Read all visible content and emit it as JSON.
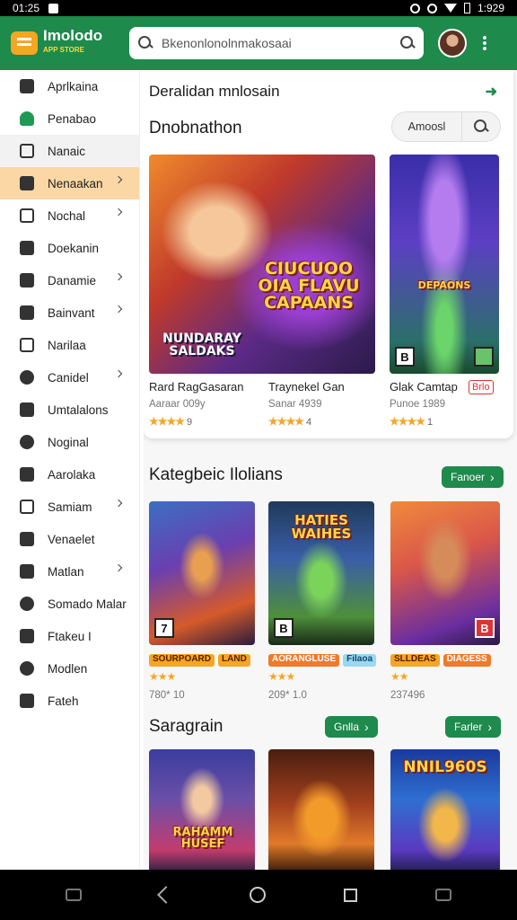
{
  "status_bar": {
    "time": "01:25",
    "clock": "1:929"
  },
  "header": {
    "logo_text": "Imolodo",
    "logo_sub": "APP STORE",
    "search_placeholder": "Bkenonlonolnmakosaai"
  },
  "sidebar": {
    "items": [
      {
        "label": "Aprlkaina",
        "icon": "home-icon",
        "chevron": false,
        "state": ""
      },
      {
        "label": "Penabao",
        "icon": "shop-icon",
        "chevron": false,
        "state": ""
      },
      {
        "label": "Nanaic",
        "icon": "square-icon",
        "chevron": false,
        "state": "grey"
      },
      {
        "label": "Nenaakan",
        "icon": "user-icon",
        "chevron": true,
        "state": "active"
      },
      {
        "label": "Nochal",
        "icon": "box-icon",
        "chevron": true,
        "state": ""
      },
      {
        "label": "Doekanin",
        "icon": "person-icon",
        "chevron": false,
        "state": ""
      },
      {
        "label": "Danamie",
        "icon": "leaf-icon",
        "chevron": true,
        "state": ""
      },
      {
        "label": "Bainvant",
        "icon": "tools-icon",
        "chevron": true,
        "state": ""
      },
      {
        "label": "Narilaa",
        "icon": "image-icon",
        "chevron": false,
        "state": ""
      },
      {
        "label": "Canidel",
        "icon": "tag-icon",
        "chevron": true,
        "state": ""
      },
      {
        "label": "Umtalalons",
        "icon": "grid-icon",
        "chevron": false,
        "state": ""
      },
      {
        "label": "Noginal",
        "icon": "globe-icon",
        "chevron": false,
        "state": ""
      },
      {
        "label": "Aarolaka",
        "icon": "picture-icon",
        "chevron": false,
        "state": ""
      },
      {
        "label": "Samiam",
        "icon": "list-icon",
        "chevron": true,
        "state": ""
      },
      {
        "label": "Venaelet",
        "icon": "apps-icon",
        "chevron": false,
        "state": ""
      },
      {
        "label": "Matlan",
        "icon": "profile-icon",
        "chevron": true,
        "state": ""
      },
      {
        "label": "Somado Malar",
        "icon": "target-icon",
        "chevron": false,
        "state": ""
      },
      {
        "label": "Ftakeu I",
        "icon": "feather-icon",
        "chevron": false,
        "state": ""
      },
      {
        "label": "Modlen",
        "icon": "circle-icon",
        "chevron": false,
        "state": ""
      },
      {
        "label": "Fateh",
        "icon": "pen-icon",
        "chevron": false,
        "state": ""
      }
    ]
  },
  "main": {
    "top_heading": "Deralidan mnlosain",
    "featured_title": "Dnobnathon",
    "filter_label": "Amoosl",
    "featured_cards": [
      {
        "name": "Rard RagGasaran",
        "meta": "Aaraar 009y",
        "rating": "★★★★",
        "rating_num": "9",
        "art_title": "CIUCUOO OIA FLAVU CAPAANS",
        "art_sub": "NUNDARAY SALDAKS",
        "badge": ""
      },
      {
        "name": "Traynekel Gan",
        "meta": "Sanar 4939",
        "rating": "★★★★",
        "rating_num": "4",
        "art_title": "",
        "art_sub": "",
        "badge": ""
      },
      {
        "name": "Glak Camtap",
        "meta": "Punoe 1989",
        "rating": "★★★★",
        "rating_num": "1",
        "art_title": "DEPAONS",
        "art_sub": "",
        "badge": "B",
        "tag": "Brlo"
      }
    ],
    "section2": {
      "title": "Kategbeic Ilolians",
      "button": "Fanoer",
      "cards": [
        {
          "rating": "★★★",
          "meta": "780* 10",
          "tag_a": "SOURPOARD",
          "tag_b": "LAND",
          "badge": "7"
        },
        {
          "rating": "★★★",
          "meta": "209* 1.0",
          "tag_a": "AORANGLUSE",
          "tag_b": "Filaoa",
          "art_title": "HATIES WAIHES",
          "badge": "B"
        },
        {
          "rating": "★★",
          "meta": "237496",
          "tag_a": "SLLDEAS",
          "tag_b": "DIAGESS",
          "badge": "B"
        }
      ]
    },
    "section3": {
      "title": "Saragrain",
      "button_a": "Gnlla",
      "button_b": "Farler",
      "cards": [
        {
          "art_title": "RAHAMM HUSEF"
        },
        {
          "art_title": ""
        },
        {
          "art_title": "NNIL960S"
        }
      ]
    }
  }
}
